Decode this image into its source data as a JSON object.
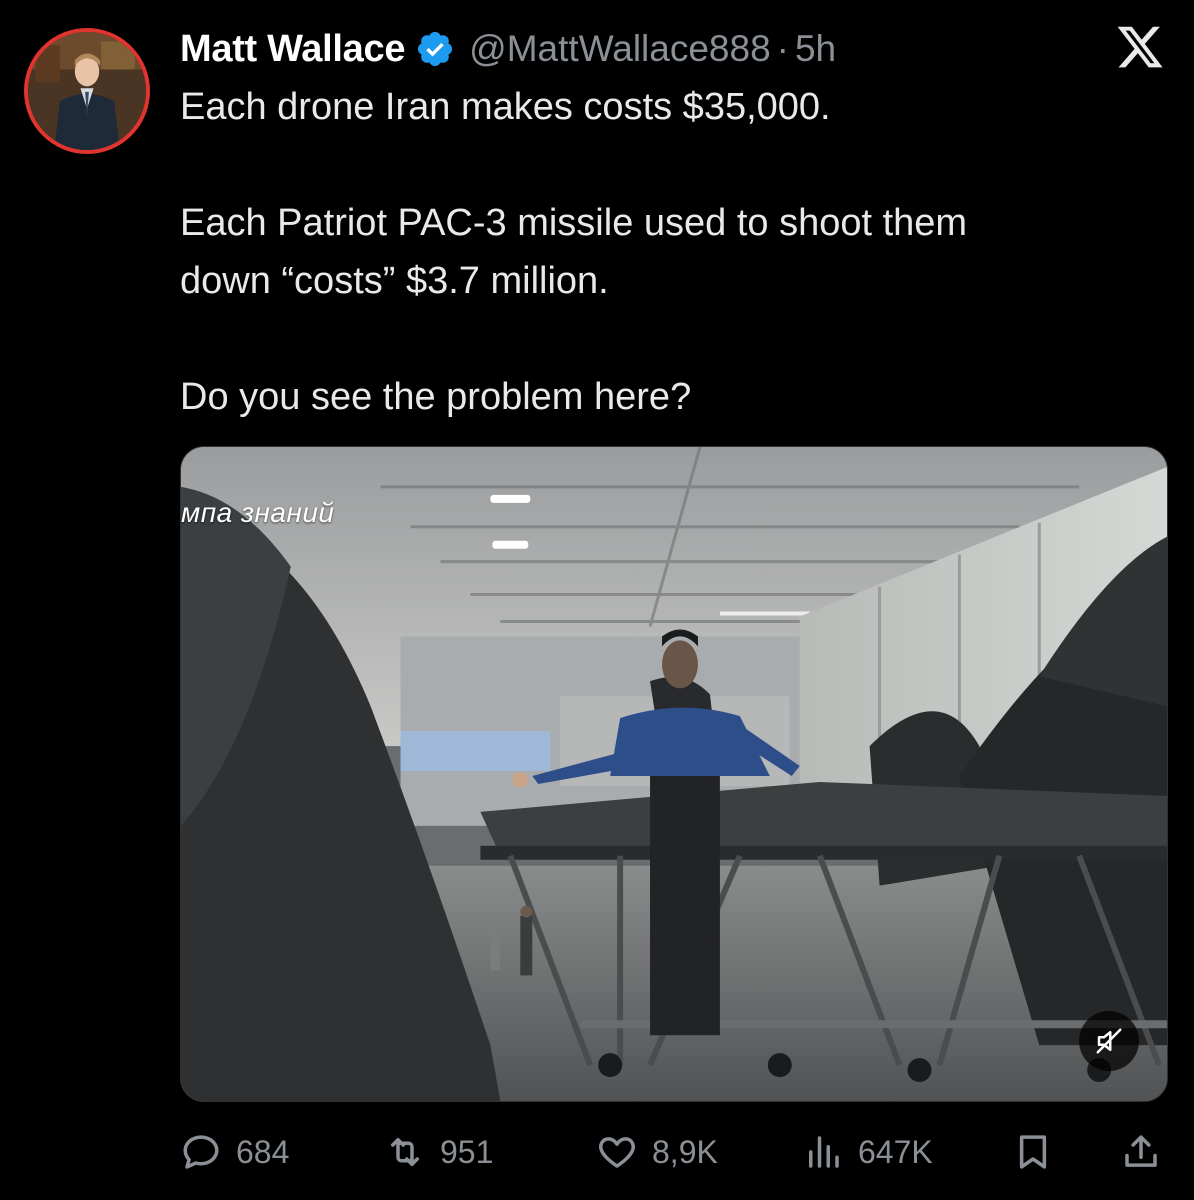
{
  "author": {
    "display_name": "Matt Wallace",
    "handle": "@MattWallace888",
    "separator": "·",
    "time": "5h",
    "verified": true
  },
  "tweet": {
    "line1": "Each drone Iran makes costs $35,000.",
    "line2": "Each Patriot PAC-3 missile used to shoot them",
    "line3": "down “costs” $3.7 million.",
    "line4": "Do you see the problem here?"
  },
  "media": {
    "watermark": "мпа знаний",
    "mute_icon": "speaker-muted-icon"
  },
  "actions": {
    "replies": "684",
    "reposts": "951",
    "likes": "8,9K",
    "views": "647K"
  },
  "colors": {
    "background": "#000000",
    "text": "#e7e9ea",
    "secondary": "#8b9096",
    "verified_blue": "#1d9bf0",
    "avatar_ring": "#e0342f"
  }
}
